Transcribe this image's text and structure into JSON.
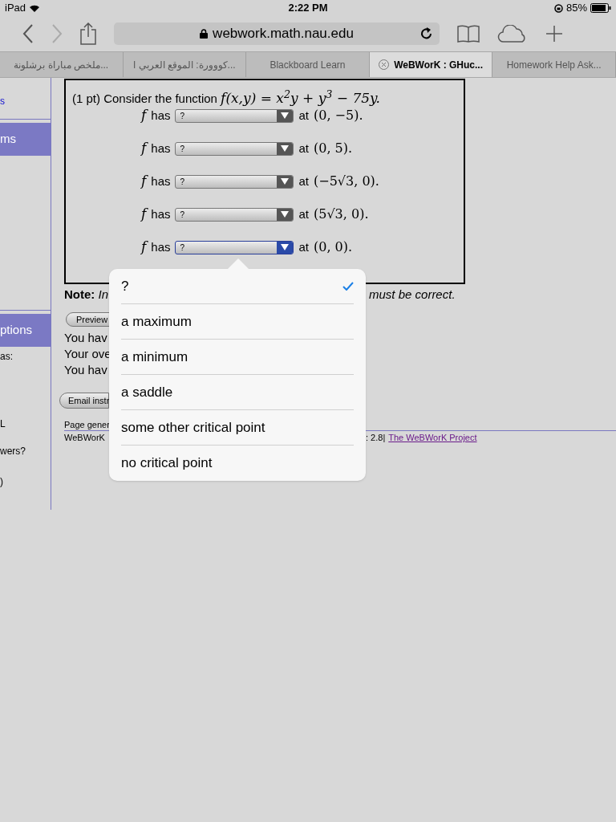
{
  "status_bar": {
    "device": "iPad",
    "time": "2:22 PM",
    "battery": "85%"
  },
  "toolbar": {
    "url": "webwork.math.nau.edu"
  },
  "tabs": [
    {
      "label": "ملخص مباراة برشلونة...",
      "selected": false
    },
    {
      "label": "كووورة: الموقع العربي ا...",
      "selected": false
    },
    {
      "label": "Blackboard Learn",
      "selected": false
    },
    {
      "label": "WeBWorK : GHuc...",
      "selected": true
    },
    {
      "label": "Homework Help Ask...",
      "selected": false
    }
  ],
  "sidebar": {
    "link_fragment": "s",
    "headers": [
      "ms",
      "ptions"
    ],
    "fragments": [
      "as:",
      "L",
      "wers?",
      ")"
    ]
  },
  "problem": {
    "intro": "(1 pt) Consider the function",
    "function": "f(x,y) = x$^{2}$y + y$^{3}$ − 75y.",
    "rows": [
      {
        "f": "f",
        "label": "has",
        "value": "?",
        "at": "at",
        "point": "(0, −5).",
        "focused": false
      },
      {
        "f": "f",
        "label": "has",
        "value": "?",
        "at": "at",
        "point": "(0, 5).",
        "focused": false
      },
      {
        "f": "f",
        "label": "has",
        "value": "?",
        "at": "at",
        "point": "(−5√3, 0).",
        "focused": false
      },
      {
        "f": "f",
        "label": "has",
        "value": "?",
        "at": "at",
        "point": "(5√3, 0).",
        "focused": false
      },
      {
        "f": "f",
        "label": "has",
        "value": "?",
        "at": "at",
        "point": "(0, 0).",
        "focused": true
      }
    ]
  },
  "below": {
    "note_left": "**Note:** *In*",
    "note_right": "must be correct.",
    "preview_button": "Preview",
    "attempt_lines": [
      "You hav",
      "Your ove",
      "You hav"
    ],
    "email_button": "Email instr",
    "page_generated": "Page gener",
    "footer_left": "WeBWorK",
    "footer_right": ": 2.8|",
    "footer_link": "The WeBWorK Project"
  },
  "popover": {
    "options": [
      {
        "label": "?",
        "selected": true
      },
      {
        "label": "a maximum",
        "selected": false
      },
      {
        "label": "a minimum",
        "selected": false
      },
      {
        "label": "a saddle",
        "selected": false
      },
      {
        "label": "some other critical point",
        "selected": false
      },
      {
        "label": "no critical point",
        "selected": false
      }
    ]
  }
}
